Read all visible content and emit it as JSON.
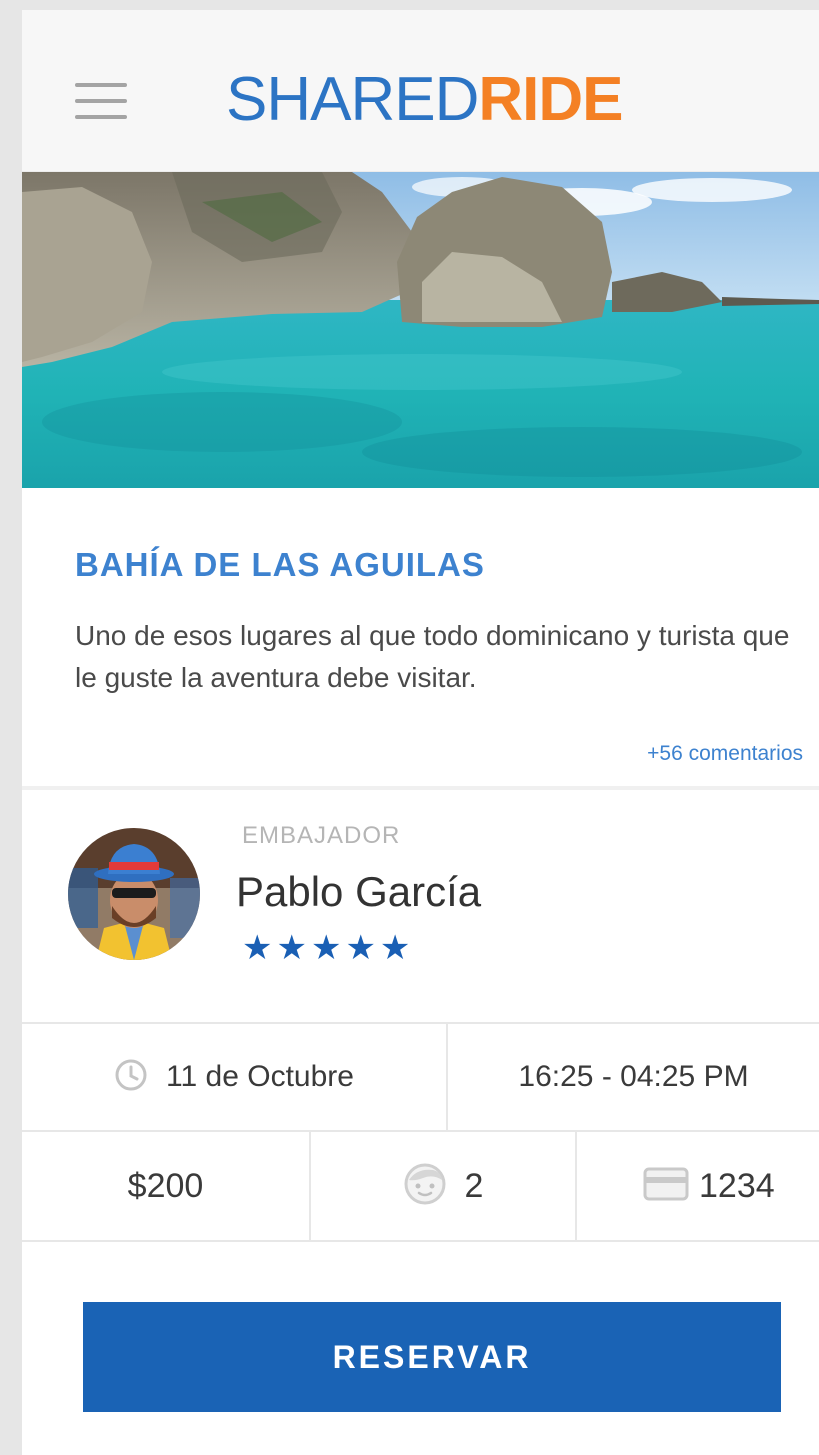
{
  "header": {
    "logo_part1": "SHARED",
    "logo_part2": "RIDE",
    "colors": {
      "logo_blue": "#2c74c4",
      "logo_orange": "#f48024"
    },
    "menu_icon": "hamburger-menu-icon"
  },
  "place": {
    "title": "BAHÍA DE LAS AGUILAS",
    "description": "Uno de esos lugares al que todo dominicano y turista que le guste la aventura debe visitar.",
    "comments": "+56 comentarios"
  },
  "ambassador": {
    "label": "EMBAJADOR",
    "name": "Pablo García",
    "rating": 5,
    "stars": "★★★★★"
  },
  "details": {
    "date": "11 de Octubre",
    "time": "16:25 - 04:25 PM",
    "price": "$200",
    "passengers": "2",
    "card": "1234",
    "icons": {
      "date": "clock-icon",
      "passengers": "face-icon",
      "card": "credit-card-icon"
    }
  },
  "action": {
    "reserve_label": "RESERVAR",
    "color": "#1a63b5"
  }
}
